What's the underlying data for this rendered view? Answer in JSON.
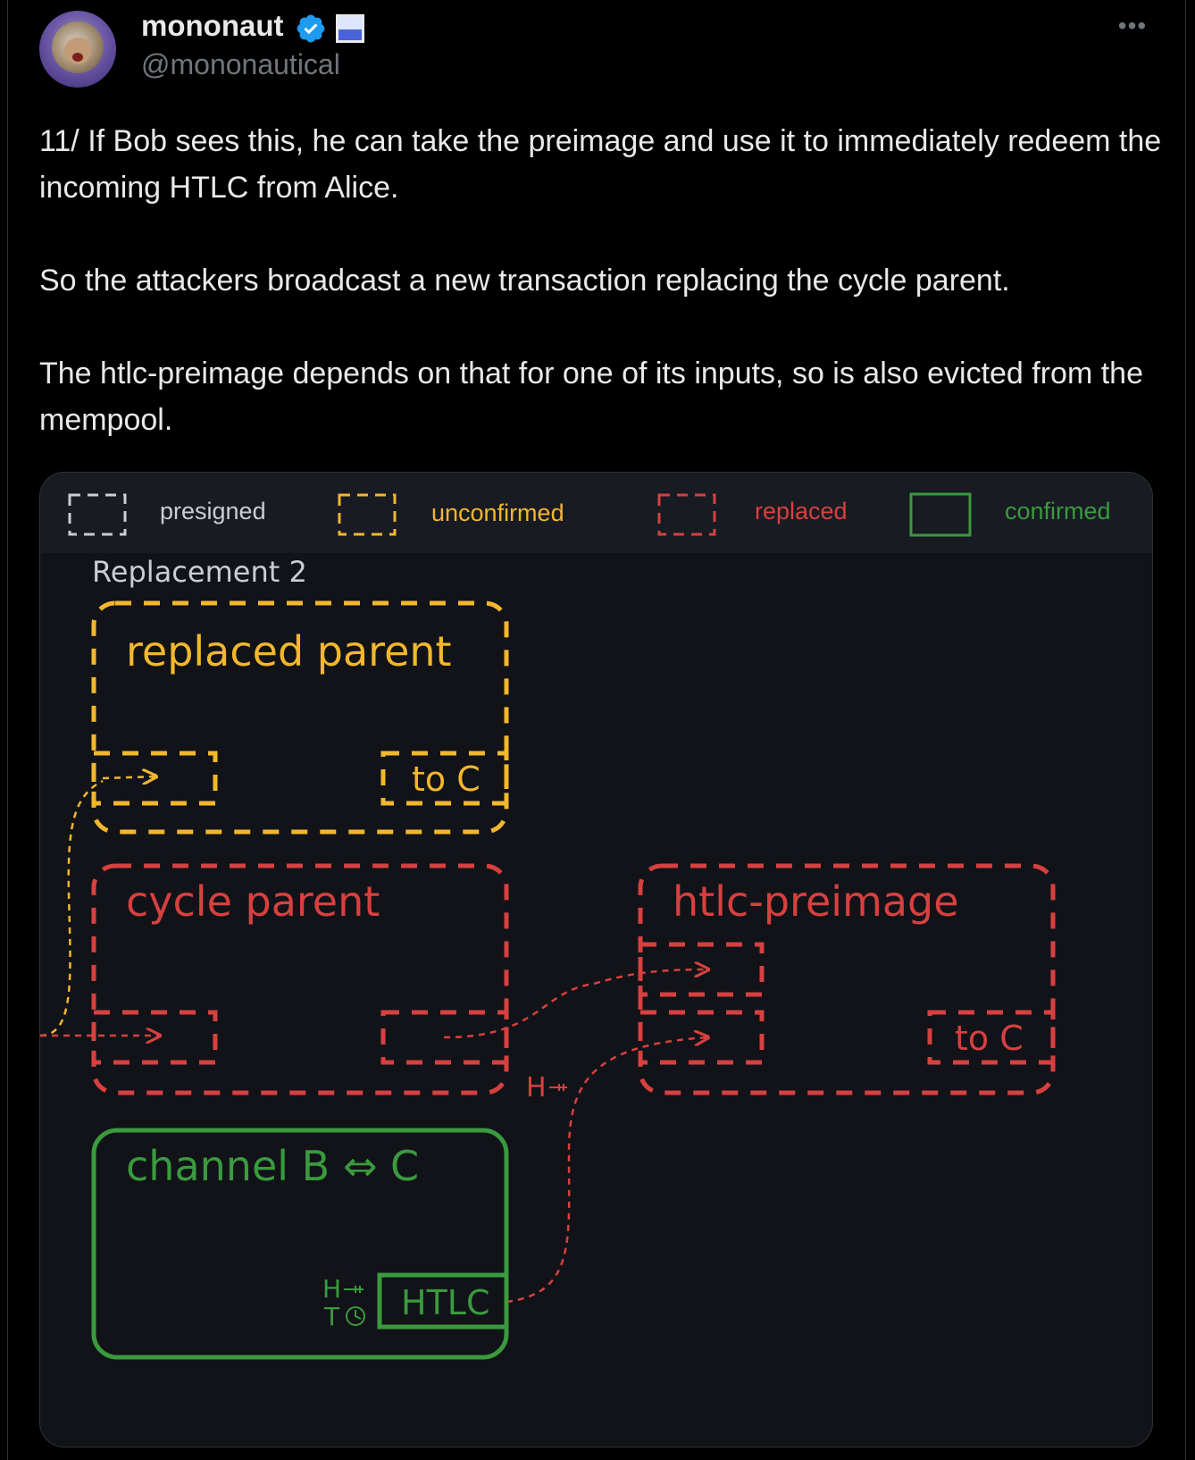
{
  "author": {
    "display_name": "mononaut",
    "handle": "@mononautical"
  },
  "tweet": {
    "paragraphs": [
      "11/ If Bob sees this, he can take the preimage and use it to immediately redeem the incoming HTLC from Alice.",
      "So the attackers broadcast a new transaction replacing the cycle parent.",
      "The htlc-preimage depends on that for one of its inputs, so is also evicted from the mempool."
    ]
  },
  "colors": {
    "presigned": "#c9cdd4",
    "unconfirmed": "#f2b72d",
    "replaced": "#d7403f",
    "confirmed": "#3a9a3e",
    "legend_presigned_text": "#c9cdd4",
    "legend_unconfirmed_text": "#f2b72d",
    "legend_replaced_text": "#d7403f",
    "legend_confirmed_text": "#3a9a3e"
  },
  "legend": {
    "presigned": "presigned",
    "unconfirmed": "unconfirmed",
    "replaced": "replaced",
    "confirmed": "confirmed"
  },
  "diagram": {
    "title": "Replacement 2",
    "replaced_parent": {
      "label": "replaced parent",
      "output": "to C"
    },
    "cycle_parent": {
      "label": "cycle parent"
    },
    "htlc_preimage": {
      "label": "htlc-preimage",
      "output": "to C"
    },
    "channel": {
      "label": "channel B ⇔ C",
      "htlc": "HTLC",
      "hash_mark": "H",
      "time_mark": "T"
    },
    "hash_link_mark": "H"
  },
  "icons": {
    "verified": "verified-badge-icon",
    "affiliate": "affiliate-badge-icon",
    "more": "more-icon"
  }
}
